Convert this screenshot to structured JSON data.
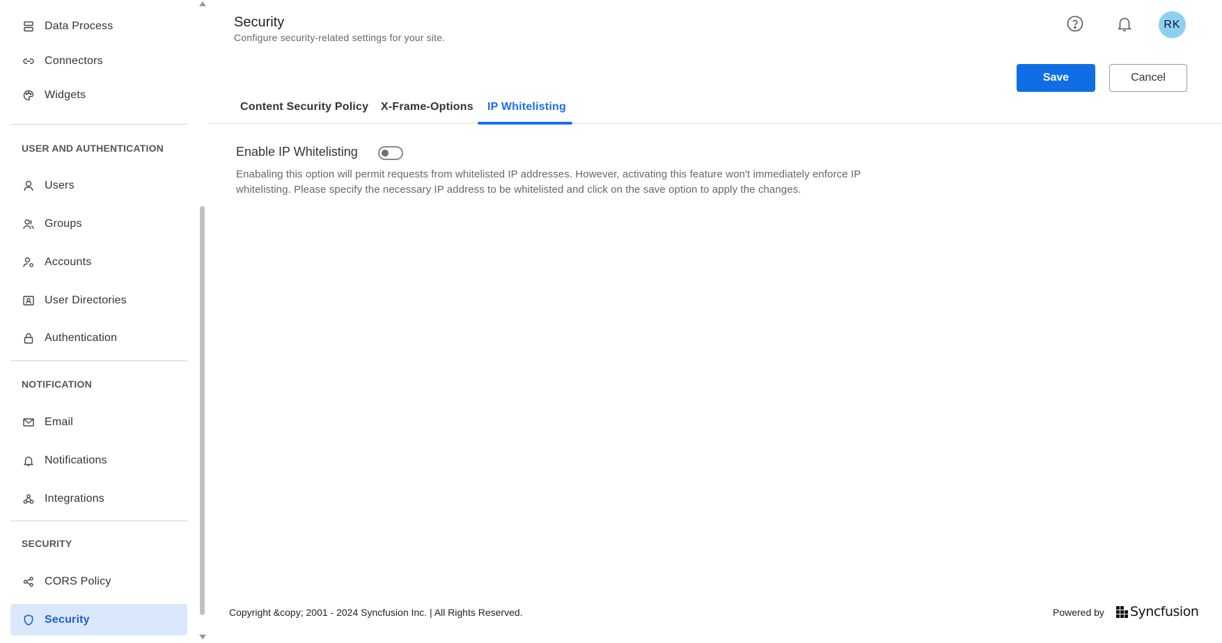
{
  "sidebar": {
    "items": [
      {
        "label": "Data Process",
        "icon": "server-icon"
      },
      {
        "label": "Connectors",
        "icon": "link-icon"
      },
      {
        "label": "Widgets",
        "icon": "palette-icon"
      },
      {
        "label": "Users",
        "icon": "user-icon"
      },
      {
        "label": "Groups",
        "icon": "group-icon"
      },
      {
        "label": "Accounts",
        "icon": "user-gear-icon"
      },
      {
        "label": "User Directories",
        "icon": "id-card-icon"
      },
      {
        "label": "Authentication",
        "icon": "lock-icon"
      },
      {
        "label": "Email",
        "icon": "mail-icon"
      },
      {
        "label": "Notifications",
        "icon": "bell-icon"
      },
      {
        "label": "Integrations",
        "icon": "webhook-icon"
      },
      {
        "label": "CORS Policy",
        "icon": "share-nodes-icon"
      },
      {
        "label": "Security",
        "icon": "shield-icon"
      }
    ],
    "sections": {
      "user_auth": "USER AND AUTHENTICATION",
      "notification": "NOTIFICATION",
      "security": "SECURITY"
    },
    "active_item": "Security"
  },
  "header": {
    "title": "Security",
    "subtitle": "Configure security-related settings for your site.",
    "avatar_initials": "RK"
  },
  "actions": {
    "save_label": "Save",
    "cancel_label": "Cancel"
  },
  "tabs": [
    {
      "label": "Content Security Policy"
    },
    {
      "label": "X-Frame-Options"
    },
    {
      "label": "IP Whitelisting"
    }
  ],
  "active_tab": "IP Whitelisting",
  "ip_whitelisting": {
    "toggle_label": "Enable IP Whitelisting",
    "enabled": false,
    "description": "Enabaling this option will permit requests from whitelisted IP addresses. However, activating this feature won't immediately enforce IP whitelisting. Please specify the necessary IP address to be whitelisted and click on the save option to apply the changes."
  },
  "footer": {
    "copyright": "Copyright &copy; 2001 - 2024 Syncfusion Inc. | All Rights Reserved.",
    "powered_by": "Powered by",
    "brand": "Syncfusion"
  },
  "colors": {
    "accent": "#0f6de6",
    "active_nav_bg": "#dbe8fb",
    "avatar_bg": "#8fd0f2"
  }
}
